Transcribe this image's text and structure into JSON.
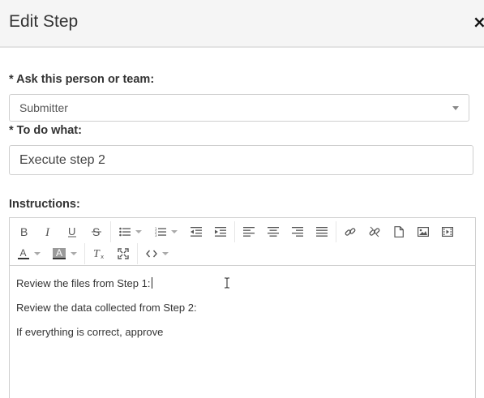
{
  "dialog": {
    "title": "Edit Step",
    "close_icon": "×"
  },
  "form": {
    "assignee_label": "* Ask this person or team:",
    "assignee_value": "Submitter",
    "task_label": "* To do what:",
    "task_value": "Execute step 2",
    "instructions_label": "Instructions:"
  },
  "editor": {
    "toolbar_icons": [
      "bold-icon",
      "italic-icon",
      "underline-icon",
      "strikethrough-icon",
      "bullet-list-icon",
      "numbered-list-icon",
      "outdent-icon",
      "indent-icon",
      "align-left-icon",
      "align-center-icon",
      "align-right-icon",
      "align-justify-icon",
      "link-icon",
      "unlink-icon",
      "document-icon",
      "image-icon",
      "video-icon",
      "text-color-icon",
      "highlight-color-icon",
      "clear-format-icon",
      "fullscreen-icon",
      "code-icon"
    ],
    "lines": [
      "Review the files from Step 1:",
      "Review the data collected from Step 2:",
      "If everything is correct, approve"
    ]
  },
  "colors": {
    "header_bg": "#f5f5f5",
    "border": "#cfcfcf",
    "icon": "#555555"
  }
}
